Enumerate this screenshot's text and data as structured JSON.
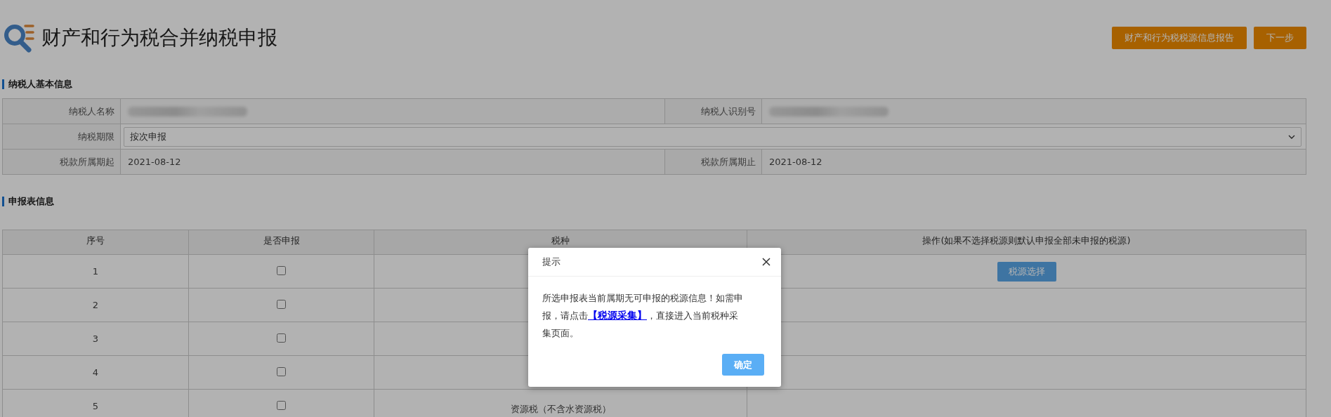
{
  "header": {
    "title": "财产和行为税合并纳税申报",
    "buttons": [
      "财产和行为税税源信息报告",
      "下一步"
    ]
  },
  "taxpayer_section": {
    "heading": "纳税人基本信息",
    "rows": [
      {
        "kind": "pair",
        "cells": [
          {
            "label": "纳税人名称",
            "redacted": true
          },
          {
            "label": "纳税人识别号",
            "redacted": true
          }
        ]
      },
      {
        "kind": "select",
        "label": "纳税期限",
        "value": "按次申报"
      },
      {
        "kind": "pair",
        "cells": [
          {
            "label": "税款所属期起",
            "value": "2021-08-12"
          },
          {
            "label": "税款所属期止",
            "value": "2021-08-12"
          }
        ]
      }
    ]
  },
  "declaration_section": {
    "heading": "申报表信息",
    "columns": [
      "序号",
      "是否申报",
      "税种",
      "操作(如果不选择税源则默认申报全部未申报的税源)"
    ],
    "rows": [
      {
        "index": "1",
        "checked": false,
        "action": "税源选择"
      },
      {
        "index": "2",
        "checked": false
      },
      {
        "index": "3",
        "checked": false
      },
      {
        "index": "4",
        "checked": false
      },
      {
        "index": "5",
        "checked": false,
        "tax": "资源税（不含水资源税）"
      }
    ]
  },
  "dialog": {
    "title": "提示",
    "message_before": "所选申报表当前属期无可申报的税源信息！如需申报，请点击",
    "link": "【税源采集】",
    "message_after": "，直接进入当前税种采集页面。",
    "button": "确定"
  }
}
